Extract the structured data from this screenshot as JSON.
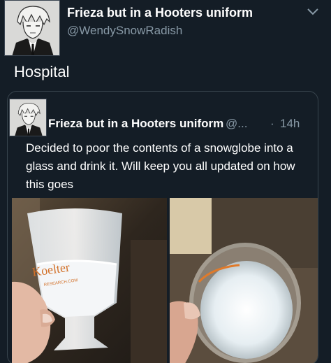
{
  "tweet": {
    "author_name": "Frieza but in a Hooters uniform",
    "author_handle": "@WendySnowRadish",
    "text": "Hospital"
  },
  "quoted_tweet": {
    "author_name": "Frieza but in a Hooters uniform",
    "author_handle": "@...",
    "separator": "·",
    "time": "14h",
    "text": "Decided to poor the contents of a snowglobe into a glass and drink it. Will keep you all updated on how this goes"
  },
  "photos": {
    "left_glass_text": "Koelter",
    "left_glass_subtext": "RESEARCH.COM"
  },
  "icons": [
    "chevron-down-icon"
  ],
  "colors": {
    "background": "#141d26",
    "secondary_text": "#8899a6",
    "border": "#38444d"
  }
}
